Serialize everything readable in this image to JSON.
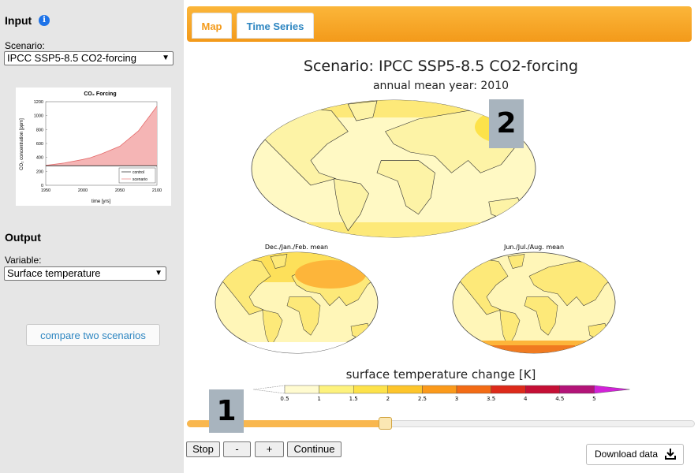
{
  "sidebar": {
    "input_title": "Input",
    "info_icon": "i",
    "scenario_label": "Scenario:",
    "scenario_value": "IPCC SSP5-8.5 CO2-forcing",
    "output_title": "Output",
    "variable_label": "Variable:",
    "variable_value": "Surface temperature",
    "compare_button": "compare two scenarios"
  },
  "thumb_chart": {
    "title": "CO₂ Forcing",
    "ylabel": "CO₂ concentration [ppm]",
    "xlabel": "time [yrs]",
    "yticks": [
      "0",
      "200",
      "400",
      "600",
      "800",
      "1000",
      "1200"
    ],
    "xticks": [
      "1950",
      "2000",
      "2050",
      "2100"
    ],
    "legend": [
      "control",
      "scenario"
    ]
  },
  "chart_data": {
    "type": "area",
    "title": "CO₂ Forcing",
    "xlabel": "time [yrs]",
    "ylabel": "CO₂ concentration [ppm]",
    "xlim": [
      1950,
      2100
    ],
    "ylim": [
      0,
      1200
    ],
    "x": [
      1950,
      1975,
      2000,
      2010,
      2025,
      2050,
      2075,
      2100
    ],
    "series": [
      {
        "name": "control",
        "values": [
          280,
          280,
          280,
          280,
          280,
          280,
          280,
          280
        ]
      },
      {
        "name": "scenario",
        "values": [
          285,
          320,
          370,
          395,
          450,
          560,
          780,
          1135
        ]
      }
    ]
  },
  "tabs": [
    "Map",
    "Time Series"
  ],
  "map": {
    "title": "Scenario: IPCC SSP5-8.5 CO2-forcing",
    "subtitle": "annual mean year: 2010",
    "djf_label": "Dec./Jan./Feb. mean",
    "jja_label": "Jun./Jul./Aug. mean",
    "colorbar_title": "surface temperature change [K]",
    "colorbar_ticks": [
      "0.5",
      "1",
      "1.5",
      "2",
      "2.5",
      "3",
      "3.5",
      "4",
      "4.5",
      "5"
    ],
    "colorbar_colors": [
      "#fffbd0",
      "#fdf27d",
      "#fde24a",
      "#fdc52b",
      "#fb9a1b",
      "#f36b15",
      "#dd2a1a",
      "#c50f35",
      "#b31478",
      "#d222d8"
    ]
  },
  "slider": {
    "value_fraction": 0.39
  },
  "controls": {
    "stop": "Stop",
    "minus": "-",
    "plus": "+",
    "continue": "Continue"
  },
  "download": {
    "label": "Download data"
  },
  "markers": {
    "m1": "1",
    "m2": "2"
  }
}
